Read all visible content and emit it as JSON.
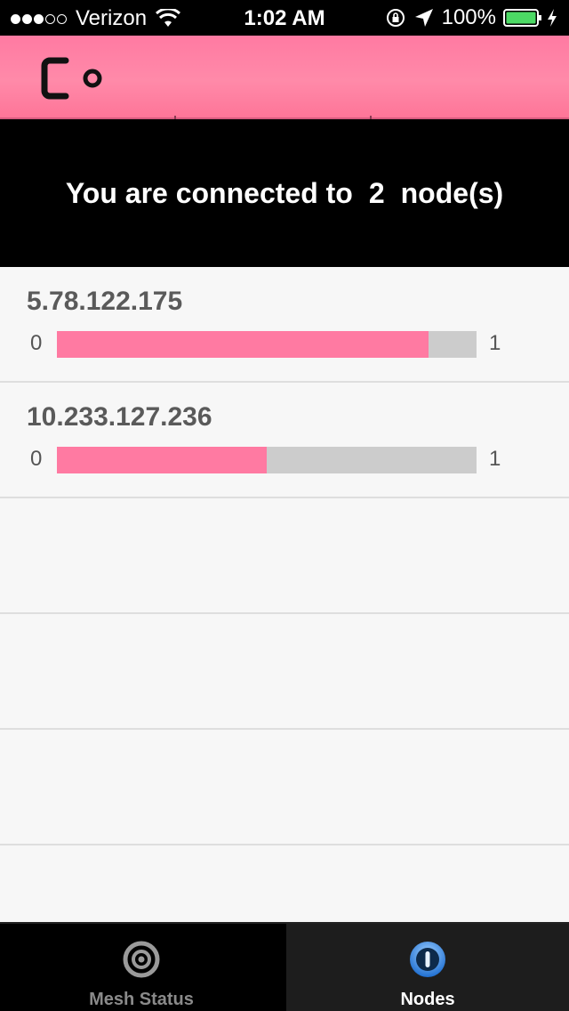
{
  "status_bar": {
    "carrier": "Verizon",
    "time": "1:02 AM",
    "battery": "100%",
    "signal_bars_filled": 3,
    "signal_bars_total": 5
  },
  "header": {
    "logo_icon": "co-logo-icon",
    "brand_color": "#ff7aa2"
  },
  "banner": {
    "prefix": "You are connected to",
    "count": "2",
    "suffix": "node(s)"
  },
  "nodes": [
    {
      "ip": "5.78.122.175",
      "min": "0",
      "max": "1",
      "level": 0.885
    },
    {
      "ip": "10.233.127.236",
      "min": "0",
      "max": "1",
      "level": 0.5
    }
  ],
  "tabs": [
    {
      "label": "Mesh Status",
      "icon": "target-icon",
      "selected": false
    },
    {
      "label": "Nodes",
      "icon": "compass-icon",
      "selected": true
    }
  ],
  "colors": {
    "bar_fill": "#ff7aa2",
    "bar_track": "#cccccc",
    "accent_blue": "#2a7fd8"
  }
}
